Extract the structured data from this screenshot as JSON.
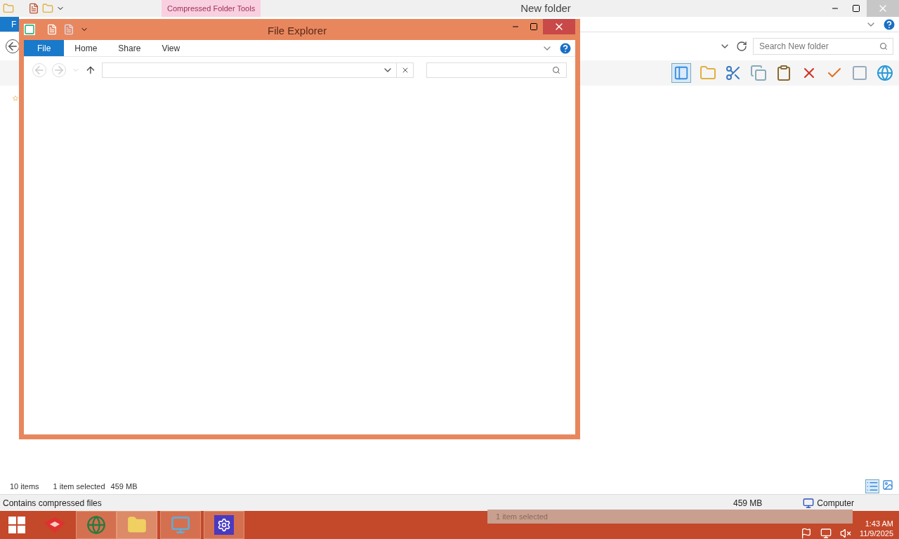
{
  "back_window": {
    "title": "New folder",
    "contextual_tab": "Compressed Folder Tools",
    "ribbon_tabs": [
      {
        "label": "F",
        "selected": true
      }
    ],
    "search": {
      "placeholder": "Search New folder"
    },
    "status": {
      "item_count": "10 items",
      "selection": "1 item selected",
      "selection_size": "459 MB"
    },
    "details_bar": {
      "description": "Contains compressed files",
      "size": "459 MB",
      "location": "Computer"
    }
  },
  "front_window": {
    "title": "File Explorer",
    "tabs": [
      {
        "label": "File",
        "selected": true
      },
      {
        "label": "Home",
        "selected": false
      },
      {
        "label": "Share",
        "selected": false
      },
      {
        "label": "View",
        "selected": false
      }
    ]
  },
  "taskbar": {
    "preview_text": "1 item selected",
    "clock": {
      "time": "1:43 AM",
      "date": "11/9/2025"
    }
  }
}
